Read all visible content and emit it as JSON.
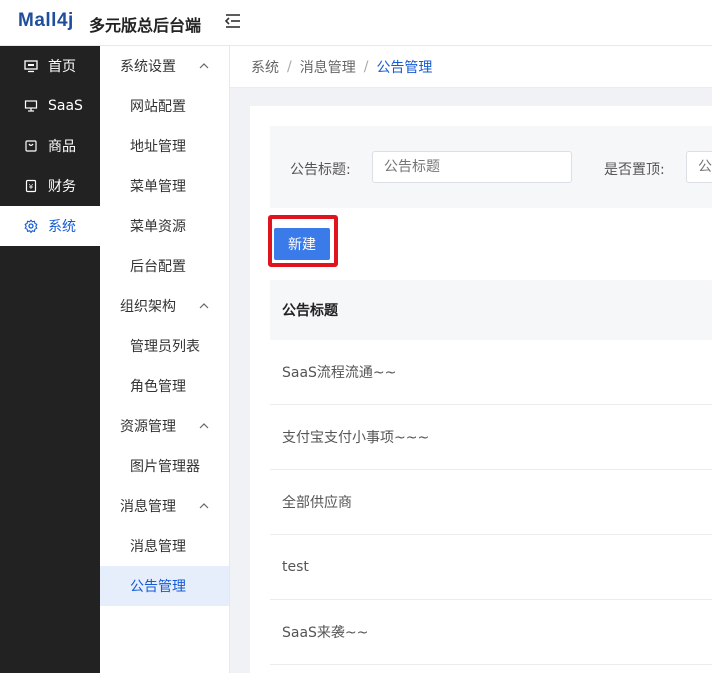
{
  "app": {
    "logo": "Mall4j",
    "title": "多元版总后台端"
  },
  "nav": [
    {
      "label": "首页",
      "icon": "monitor-icon"
    },
    {
      "label": "SaaS",
      "icon": "desktop-icon"
    },
    {
      "label": "商品",
      "icon": "bag-icon"
    },
    {
      "label": "财务",
      "icon": "wallet-icon"
    },
    {
      "label": "系统",
      "icon": "gear-icon",
      "active": true
    }
  ],
  "submenu": {
    "groups": [
      {
        "label": "系统设置",
        "items": [
          "网站配置",
          "地址管理",
          "菜单管理",
          "菜单资源",
          "后台配置"
        ]
      },
      {
        "label": "组织架构",
        "items": [
          "管理员列表",
          "角色管理"
        ]
      },
      {
        "label": "资源管理",
        "items": [
          "图片管理器"
        ]
      },
      {
        "label": "消息管理",
        "items": [
          "消息管理",
          "公告管理"
        ]
      }
    ],
    "active_item": "公告管理"
  },
  "breadcrumb": [
    "系统",
    "消息管理",
    "公告管理"
  ],
  "search": {
    "title_label": "公告标题:",
    "title_placeholder": "公告标题",
    "top_label": "是否置顶:",
    "top_placeholder": "公"
  },
  "toolbar": {
    "new_label": "新建"
  },
  "table": {
    "columns": [
      "公告标题"
    ],
    "rows": [
      "SaaS流程流通~~",
      "支付宝支付小事项~~~",
      "全部供应商",
      "test",
      "SaaS来袭~~"
    ]
  },
  "colors": {
    "accent": "#155bd4",
    "nav_bg": "#222222",
    "highlight": "#e0141e",
    "button": "#3b7be9"
  }
}
